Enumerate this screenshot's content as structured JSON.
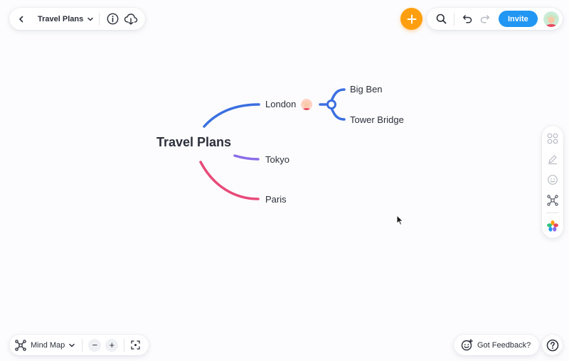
{
  "board": {
    "title": "Travel Plans"
  },
  "toolbar": {
    "invite_label": "Invite",
    "icons": {
      "back": "chevron-left-icon",
      "title_dropdown": "chevron-down-icon",
      "info": "info-icon",
      "cloud": "cloud-download-icon",
      "add": "plus-icon",
      "search": "search-icon",
      "undo": "undo-icon",
      "redo": "redo-icon"
    }
  },
  "mind_map": {
    "root": "Travel Plans",
    "branches": [
      {
        "label": "London",
        "color": "#3b6fe0",
        "has_avatar": true,
        "children": [
          "Big Ben",
          "Tower Bridge"
        ]
      },
      {
        "label": "Tokyo",
        "color": "#8a6ce8",
        "children": []
      },
      {
        "label": "Paris",
        "color": "#e84a7a",
        "children": []
      }
    ]
  },
  "right_toolbar": {
    "items": [
      "shapes-icon",
      "pen-icon",
      "sticker-icon",
      "layout-icon",
      "palette-icon"
    ]
  },
  "bottom_bar": {
    "view_label": "Mind Map",
    "zoom_out": "−",
    "zoom_in": "+",
    "fit": "fit-screen-icon"
  },
  "feedback": {
    "label": "Got Feedback?"
  },
  "help": {
    "label": "?"
  },
  "colors": {
    "accent_orange": "#ff9f0f",
    "invite_blue": "#2196f3"
  }
}
